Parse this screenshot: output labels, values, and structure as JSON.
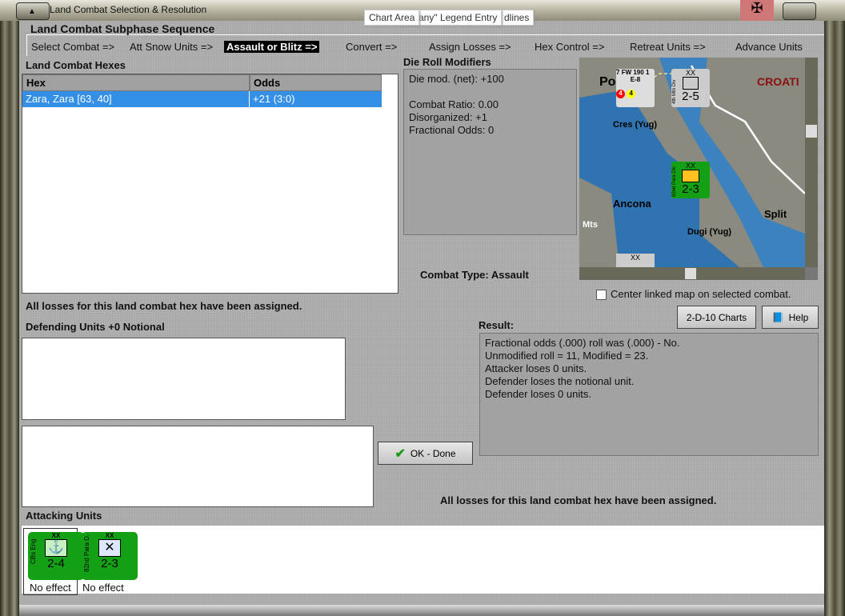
{
  "window": {
    "title": "Land Combat Selection & Resolution"
  },
  "tooltips": [
    "Chart Area",
    "many\" Legend Entry",
    "dlines"
  ],
  "subphase": {
    "title": "Land Combat Subphase Sequence",
    "steps": [
      "Select Combat =>",
      "Att Snow Units =>",
      "Assault or Blitz =>",
      "Convert =>",
      "Assign Losses =>",
      "Hex Control =>",
      "Retreat Units =>",
      "Advance Units"
    ],
    "active_index": 2
  },
  "hexes": {
    "title": "Land Combat Hexes",
    "columns": [
      "Hex",
      "Odds"
    ],
    "rows": [
      {
        "hex": "Zara, Zara [63, 40]",
        "odds": "+21 (3:0)"
      }
    ]
  },
  "modifiers": {
    "title": "Die Roll Modifiers",
    "lines": [
      "Die mod. (net): +100",
      "",
      "Combat Ratio: 0.00",
      "Disorganized: +1",
      "Fractional Odds: 0"
    ]
  },
  "map": {
    "labels": [
      "Po",
      "CROATI",
      "Cres (Yug)",
      "Ancona",
      "Split",
      "Dugi (Yug)",
      "Mts"
    ],
    "counters": [
      {
        "name": "FW 190",
        "top": "7",
        "sub": "E-8",
        "right": "1",
        "red": "4",
        "yellow": "4",
        "stack": "2"
      },
      {
        "name": "4th Mtn Div",
        "xx": "XX",
        "strength": "2-5"
      },
      {
        "name": "82nd Para Div",
        "xx": "XX",
        "strength": "2-3",
        "stack": "2"
      },
      {
        "xx": "XX"
      }
    ]
  },
  "combat_type": "Combat Type:  Assault",
  "center_map": {
    "label": "Center linked map on selected combat.",
    "checked": false
  },
  "buttons": {
    "charts": "2-D-10 Charts",
    "help": "Help",
    "ok": "OK - Done"
  },
  "losses_msg": "All losses for this land combat hex have been assigned.",
  "defending": {
    "title": "Defending Units +0 Notional"
  },
  "result": {
    "title": "Result:",
    "lines": [
      "Fractional odds (.000) roll was (.000)  - No.",
      "Unmodified roll = 11, Modified = 23.",
      "Attacker loses 0 units.",
      "Defender loses the notional unit.",
      "Defender loses 0 units."
    ]
  },
  "attacking": {
    "title": "Attacking Units",
    "units": [
      {
        "name": "CBs Eng",
        "xx": "XX",
        "strength": "2-4",
        "status": "No effect"
      },
      {
        "name": "82nd Para D.",
        "xx": "XX",
        "strength": "2-3",
        "status": "No effect"
      }
    ]
  }
}
